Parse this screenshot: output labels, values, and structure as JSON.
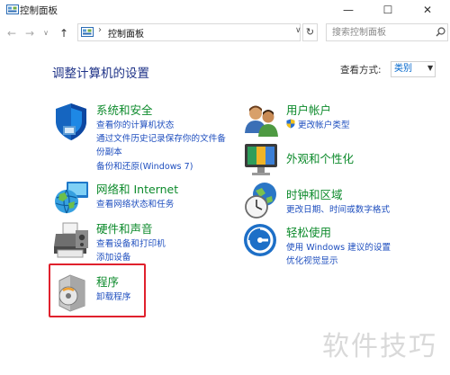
{
  "window": {
    "title": "控制面板",
    "minimize_label": "—",
    "maximize_label": "☐",
    "close_label": "✕"
  },
  "nav": {
    "back_label": "←",
    "forward_label": "→",
    "recent_label": "∨",
    "up_label": "↑",
    "address_separator": "›",
    "breadcrumb": "控制面板",
    "dropdown_label": "∨",
    "refresh_label": "↻",
    "search_placeholder": "搜索控制面板"
  },
  "header": {
    "title": "调整计算机的设置",
    "view_by_label": "查看方式:",
    "view_by_value": "类别",
    "view_by_caret": "▼"
  },
  "categories": {
    "security": {
      "title": "系统和安全",
      "links": [
        "查看你的计算机状态",
        "通过文件历史记录保存你的文件备",
        "份副本",
        "备份和还原(Windows 7)"
      ]
    },
    "network": {
      "title": "网络和 Internet",
      "links": [
        "查看网络状态和任务"
      ]
    },
    "hardware": {
      "title": "硬件和声音",
      "links": [
        "查看设备和打印机",
        "添加设备"
      ]
    },
    "programs": {
      "title": "程序",
      "links": [
        "卸载程序"
      ]
    },
    "accounts": {
      "title": "用户帐户",
      "links": [
        "更改帐户类型"
      ]
    },
    "appearance": {
      "title": "外观和个性化",
      "links": []
    },
    "clock": {
      "title": "时钟和区域",
      "links": [
        "更改日期、时间或数字格式"
      ]
    },
    "ease": {
      "title": "轻松使用",
      "links": [
        "使用 Windows 建议的设置",
        "优化视觉显示"
      ]
    }
  },
  "watermark": "软件技巧",
  "colors": {
    "category_title": "#0c8a2b",
    "link": "#1f4fbf",
    "heading": "#1e3287",
    "highlight": "#e0212d"
  }
}
